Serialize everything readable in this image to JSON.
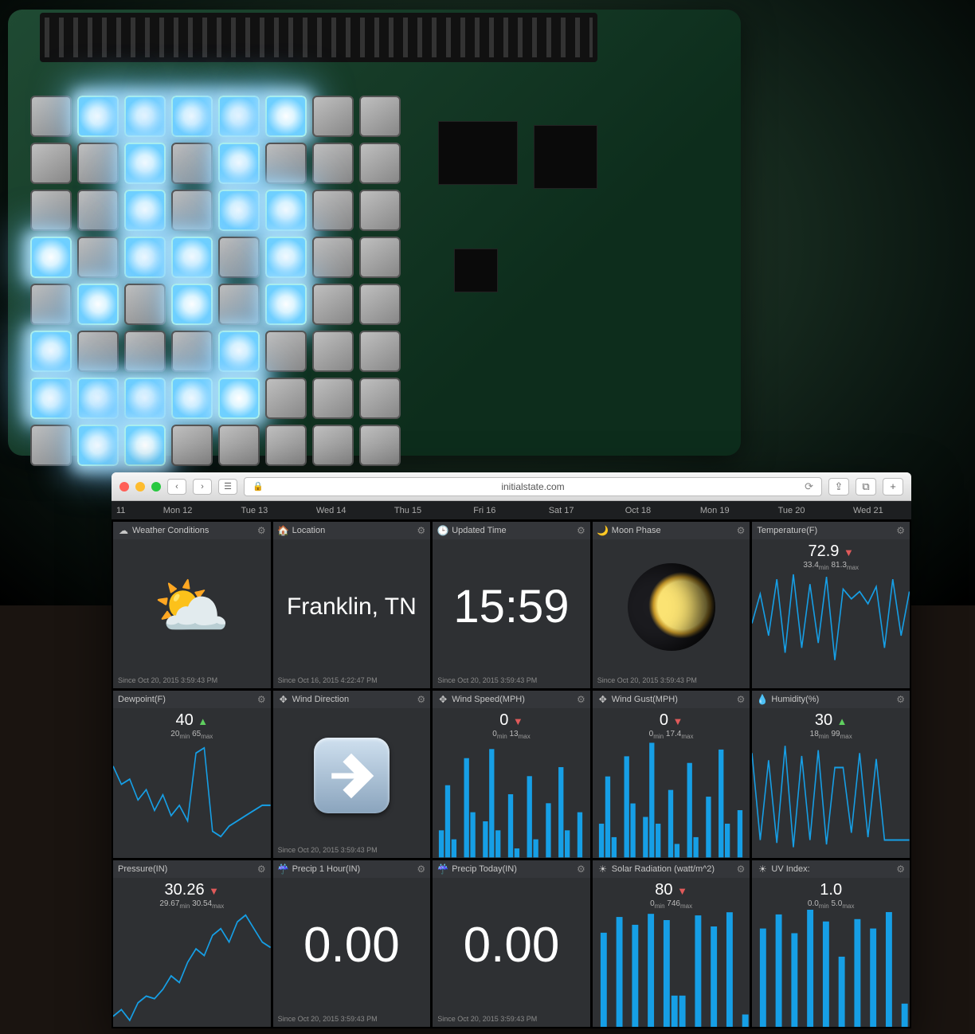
{
  "browser": {
    "domain": "initialstate.com"
  },
  "timeline": {
    "start": "11",
    "days": [
      "Mon 12",
      "Tue 13",
      "Wed 14",
      "Thu 15",
      "Fri 16",
      "Sat 17",
      "Oct 18",
      "Mon 19",
      "Tue 20",
      "Wed 21"
    ]
  },
  "tiles": {
    "conditions": {
      "title": "Weather Conditions",
      "icon": "☁",
      "emoji": "⛅",
      "foot": "Since Oct 20, 2015 3:59:43 PM"
    },
    "location": {
      "title": "Location",
      "icon": "🏠",
      "value": "Franklin, TN",
      "foot": "Since Oct 16, 2015 4:22:47 PM"
    },
    "updated": {
      "title": "Updated Time",
      "icon": "🕒",
      "value": "15:59",
      "foot": "Since Oct 20, 2015 3:59:43 PM"
    },
    "moon": {
      "title": "Moon Phase",
      "icon": "🌙",
      "foot": "Since Oct 20, 2015 3:59:43 PM"
    },
    "temperature": {
      "title": "Temperature(F)",
      "value": "72.9",
      "trend": "down",
      "min": "33.4",
      "max": "81.3"
    },
    "dewpoint": {
      "title": "Dewpoint(F)",
      "value": "40",
      "trend": "up",
      "min": "20",
      "max": "65"
    },
    "winddir": {
      "title": "Wind Direction",
      "icon": "✥",
      "foot": "Since Oct 20, 2015 3:59:43 PM"
    },
    "windspeed": {
      "title": "Wind Speed(MPH)",
      "icon": "✥",
      "value": "0",
      "trend": "down",
      "min": "0",
      "max": "13"
    },
    "windgust": {
      "title": "Wind Gust(MPH)",
      "icon": "✥",
      "value": "0",
      "trend": "down",
      "min": "0",
      "max": "17.4"
    },
    "humidity": {
      "title": "Humidity(%)",
      "icon": "💧",
      "value": "30",
      "trend": "up",
      "min": "18",
      "max": "99"
    },
    "pressure": {
      "title": "Pressure(IN)",
      "value": "30.26",
      "trend": "down",
      "min": "29.67",
      "max": "30.54"
    },
    "precip1h": {
      "title": "Precip 1 Hour(IN)",
      "icon": "☔",
      "value": "0.00",
      "foot": "Since Oct 20, 2015 3:59:43 PM"
    },
    "preciptoday": {
      "title": "Precip Today(IN)",
      "icon": "☔",
      "value": "0.00",
      "foot": "Since Oct 20, 2015 3:59:43 PM"
    },
    "solar": {
      "title": "Solar Radiation (watt/m^2)",
      "icon": "☀",
      "value": "80",
      "trend": "down",
      "min": "0",
      "max": "746"
    },
    "uv": {
      "title": "UV Index:",
      "icon": "☀",
      "value": "1.0",
      "min": "0.0",
      "max": "5.0"
    }
  },
  "led_matrix": {
    "on_cells": [
      [
        0,
        1
      ],
      [
        0,
        2
      ],
      [
        0,
        3
      ],
      [
        0,
        4
      ],
      [
        0,
        5
      ],
      [
        1,
        2
      ],
      [
        1,
        4
      ],
      [
        2,
        2
      ],
      [
        2,
        4
      ],
      [
        2,
        5
      ],
      [
        3,
        0
      ],
      [
        3,
        2
      ],
      [
        3,
        3
      ],
      [
        3,
        5
      ],
      [
        4,
        1
      ],
      [
        4,
        3
      ],
      [
        4,
        5
      ],
      [
        5,
        0
      ],
      [
        5,
        4
      ],
      [
        6,
        0
      ],
      [
        6,
        1
      ],
      [
        6,
        2
      ],
      [
        6,
        3
      ],
      [
        6,
        4
      ],
      [
        7,
        1
      ],
      [
        7,
        2
      ]
    ]
  },
  "chart_data": [
    {
      "tile": "temperature",
      "type": "line",
      "ylim": [
        33.4,
        81.3
      ],
      "values": [
        60,
        72,
        55,
        78,
        48,
        80,
        50,
        76,
        52,
        79,
        45,
        74,
        70,
        73,
        68,
        75,
        50,
        78,
        55,
        73
      ]
    },
    {
      "tile": "dewpoint",
      "type": "line",
      "ylim": [
        20,
        65
      ],
      "values": [
        55,
        48,
        50,
        42,
        46,
        38,
        44,
        36,
        40,
        34,
        60,
        62,
        30,
        28,
        32,
        34,
        36,
        38,
        40,
        40
      ]
    },
    {
      "tile": "windspeed",
      "type": "bar",
      "ylim": [
        0,
        13
      ],
      "values": [
        0,
        3,
        8,
        2,
        0,
        11,
        5,
        0,
        4,
        12,
        3,
        0,
        7,
        1,
        0,
        9,
        2,
        0,
        6,
        0,
        10,
        3,
        0,
        5,
        0
      ]
    },
    {
      "tile": "windgust",
      "type": "bar",
      "ylim": [
        0,
        17.4
      ],
      "values": [
        0,
        5,
        12,
        3,
        0,
        15,
        8,
        0,
        6,
        17,
        5,
        0,
        10,
        2,
        0,
        14,
        3,
        0,
        9,
        0,
        16,
        5,
        0,
        7,
        0
      ]
    },
    {
      "tile": "humidity",
      "type": "line",
      "ylim": [
        18,
        99
      ],
      "values": [
        90,
        30,
        85,
        28,
        95,
        25,
        88,
        30,
        92,
        27,
        80,
        80,
        35,
        90,
        32,
        86,
        30,
        30,
        30,
        30
      ]
    },
    {
      "tile": "pressure",
      "type": "line",
      "ylim": [
        29.67,
        30.54
      ],
      "values": [
        29.75,
        29.8,
        29.72,
        29.85,
        29.9,
        29.88,
        29.95,
        30.05,
        30.0,
        30.15,
        30.25,
        30.2,
        30.35,
        30.4,
        30.3,
        30.45,
        30.5,
        30.4,
        30.3,
        30.26
      ]
    },
    {
      "tile": "solar",
      "type": "bar",
      "ylim": [
        0,
        746
      ],
      "values": [
        0,
        600,
        0,
        700,
        0,
        650,
        0,
        720,
        0,
        680,
        200,
        200,
        0,
        710,
        0,
        640,
        0,
        730,
        0,
        80
      ]
    },
    {
      "tile": "uv",
      "type": "bar",
      "ylim": [
        0,
        5
      ],
      "values": [
        0,
        4.2,
        0,
        4.8,
        0,
        4.0,
        0,
        5.0,
        0,
        4.5,
        0,
        3.0,
        0,
        4.6,
        0,
        4.2,
        0,
        4.9,
        0,
        1.0
      ]
    }
  ]
}
